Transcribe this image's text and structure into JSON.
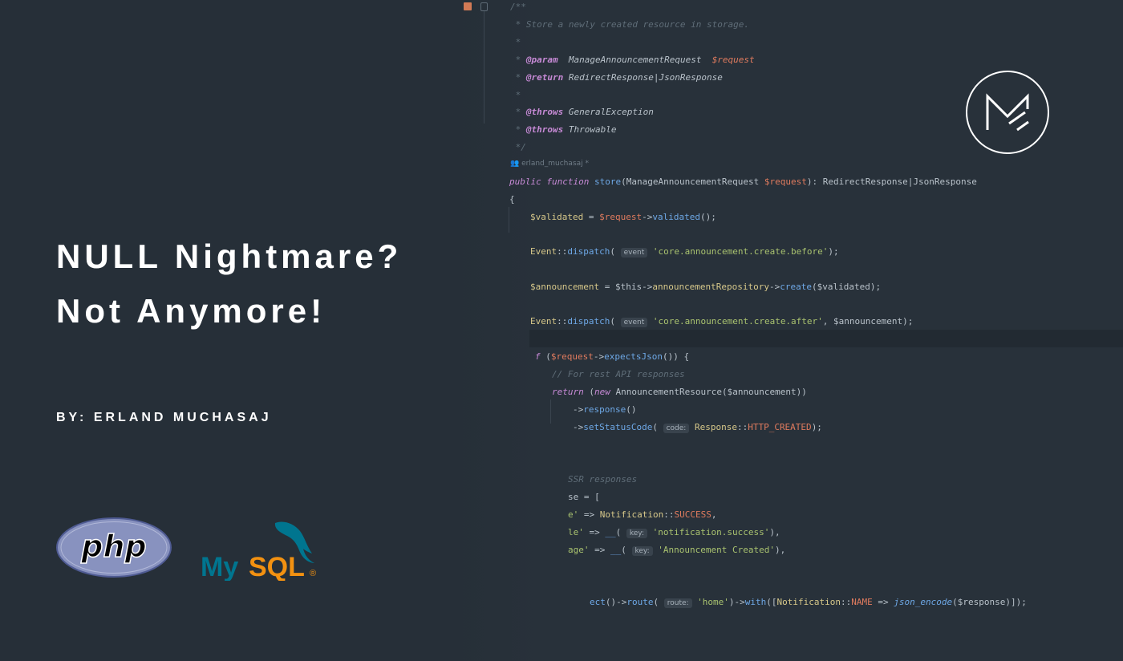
{
  "headline": {
    "line1": "NULL Nightmare?",
    "line2": "Not Anymore!"
  },
  "byline": "BY: ERLAND MUCHASAJ",
  "logos": {
    "php": "php",
    "mysql_my": "My",
    "mysql_sql": "SQL",
    "mysql_reg": "®",
    "brand_icon": "m-monogram-icon"
  },
  "colors": {
    "background": "#262f38",
    "headline": "#ffffff",
    "php_purple": "#8892bf",
    "mysql_blue": "#00758f",
    "mysql_orange": "#f29111"
  },
  "editor": {
    "author": "erland_muchasaj *",
    "lines": [
      "/**",
      " * Store a newly created resource in storage.",
      " *",
      " * @param  ManageAnnouncementRequest  $request",
      " * @return RedirectResponse|JsonResponse",
      " *",
      " * @throws GeneralException",
      " * @throws Throwable",
      " */",
      "public function store(ManageAnnouncementRequest $request): RedirectResponse|JsonResponse",
      "{",
      "$validated = $request->validated();",
      "Event::dispatch( event 'core.announcement.create.before');",
      "$announcement = $this->announcementRepository->create($validated);",
      "Event::dispatch( event 'core.announcement.create.after', $announcement);",
      "f ($request->expectsJson()) {",
      "// For rest API responses",
      "return (new AnnouncementResource($announcement))",
      "->response()",
      "->setStatusCode( code: Response::HTTP_CREATED);",
      "SSR responses",
      "se = [",
      "e' => Notification::SUCCESS,",
      "le' => __( key: 'notification.success'),",
      "age' => __( key: 'Announcement Created'),",
      "ect()->route( route: 'home')->with([Notification::NAME => json_encode($response)]);"
    ]
  }
}
